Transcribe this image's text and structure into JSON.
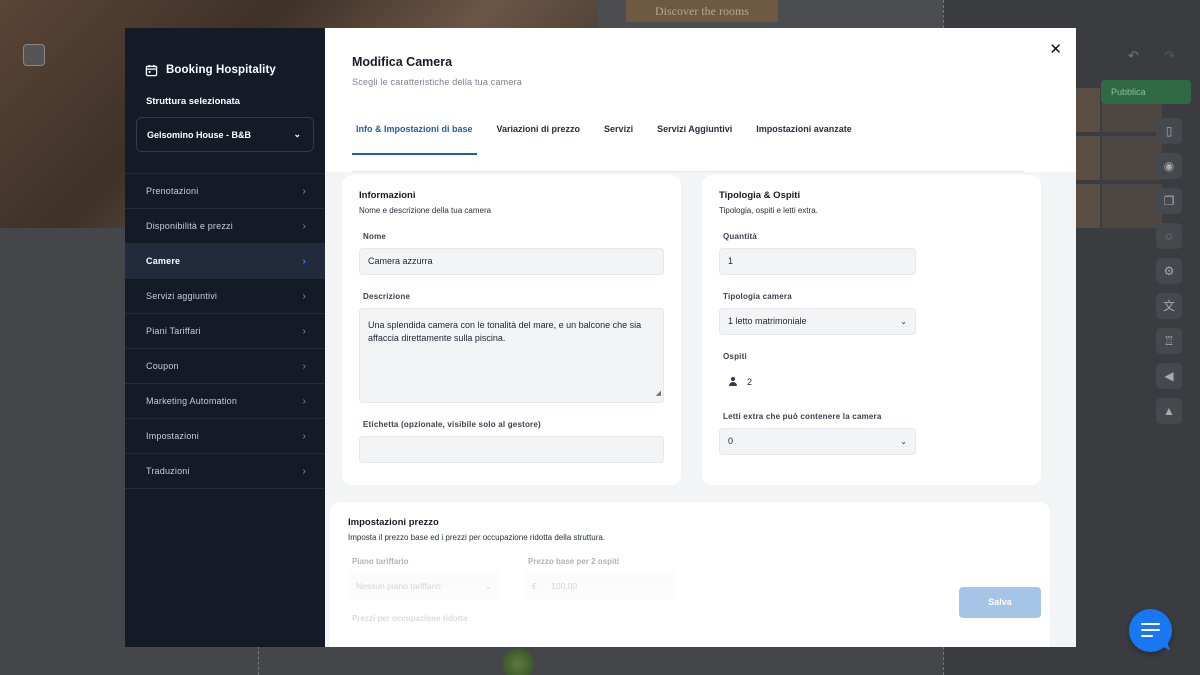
{
  "background": {
    "discover_button": "Discover the rooms",
    "publish_button": "Pubblica"
  },
  "sidebar": {
    "brand": "Booking Hospitality",
    "structure_label": "Struttura selezionata",
    "structure_value": "Gelsomino House - B&B",
    "items": [
      {
        "label": "Prenotazioni",
        "active": false
      },
      {
        "label": "Disponibilità e prezzi",
        "active": false
      },
      {
        "label": "Camere",
        "active": true
      },
      {
        "label": "Servizi aggiuntivi",
        "active": false
      },
      {
        "label": "Piani Tariffari",
        "active": false
      },
      {
        "label": "Coupon",
        "active": false
      },
      {
        "label": "Marketing Automation",
        "active": false
      },
      {
        "label": "Impostazioni",
        "active": false
      },
      {
        "label": "Traduzioni",
        "active": false
      }
    ]
  },
  "header": {
    "title": "Modifica Camera",
    "subtitle": "Scegli le caratteristiche della tua camera"
  },
  "tabs": [
    {
      "label": "Info & Impostazioni di base",
      "active": true
    },
    {
      "label": "Variazioni di prezzo",
      "active": false
    },
    {
      "label": "Servizi",
      "active": false
    },
    {
      "label": "Servizi Aggiuntivi",
      "active": false
    },
    {
      "label": "Impostazioni avanzate",
      "active": false
    }
  ],
  "info_card": {
    "title": "Informazioni",
    "subtitle": "Nome e descrizione della tua camera",
    "name_label": "Nome",
    "name_value": "Camera azzurra",
    "description_label": "Descrizione",
    "description_value": "Una splendida camera con le tonalità del mare, e un balcone che sia affaccia direttamente sulla piscina.",
    "tag_label": "Etichetta (opzionale, visibile solo al gestore)",
    "tag_value": ""
  },
  "type_card": {
    "title": "Tipologia & Ospiti",
    "subtitle": "Tipologia, ospiti e letti extra.",
    "quantity_label": "Quantità",
    "quantity_value": "1",
    "room_type_label": "Tipologia camera",
    "room_type_value": "1 letto matrimoniale",
    "guests_label": "Ospiti",
    "guests_value": "2",
    "extra_beds_label": "Letti extra che può contenere la camera",
    "extra_beds_value": "0"
  },
  "price_card": {
    "title": "Impostazioni prezzo",
    "subtitle": "Imposta il prezzo base ed i prezzi per occupazione ridotta della struttura.",
    "rate_plan_label": "Piano tariffario",
    "rate_plan_value": "Nessun piano tariffario",
    "base_price_label": "Prezzo base per 2 ospiti",
    "currency_symbol": "€",
    "base_price_value": "100,00",
    "next_label": "Prezzi per occupazione ridotta"
  },
  "actions": {
    "save_label": "Salva"
  },
  "colors": {
    "sidebar_bg": "#141a26",
    "accent": "#1e5fa8",
    "save_disabled": "#a6c4e6",
    "chat_button": "#1877f2"
  }
}
